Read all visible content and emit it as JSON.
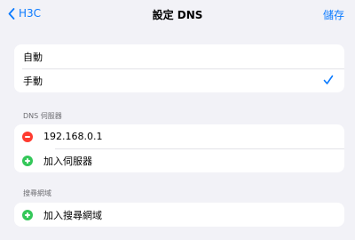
{
  "nav": {
    "back_label": "H3C",
    "title": "設定 DNS",
    "save_label": "儲存"
  },
  "mode": {
    "auto_label": "自動",
    "manual_label": "手動",
    "selected": "手動"
  },
  "dns_servers": {
    "header": "DNS 伺服器",
    "items": [
      {
        "address": "192.168.0.1"
      }
    ],
    "add_label": "加入伺服器"
  },
  "search_domains": {
    "header": "搜尋網域",
    "add_label": "加入搜尋網域"
  },
  "colors": {
    "accent": "#0a7aff",
    "remove": "#ff3b30",
    "add": "#34c759",
    "background": "#f2f2f7"
  }
}
